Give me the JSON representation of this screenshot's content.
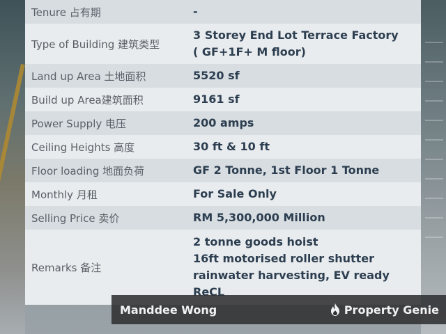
{
  "rows": [
    {
      "label": "Tenure 占有期",
      "value_lines": [
        "-"
      ]
    },
    {
      "label": "Type of Building 建筑类型",
      "value_lines": [
        "3 Storey End Lot Terrace Factory",
        "( GF+1F+ M floor)"
      ]
    },
    {
      "label": "Land up Area 土地面积",
      "value_lines": [
        "5520 sf"
      ]
    },
    {
      "label": "Build up Area建筑面积",
      "value_lines": [
        "9161 sf"
      ]
    },
    {
      "label": "Power Supply 电压",
      "value_lines": [
        "200 amps"
      ]
    },
    {
      "label": "Ceiling Heights 高度",
      "value_lines": [
        "30 ft & 10 ft"
      ]
    },
    {
      "label": "Floor loading 地面负荷",
      "value_lines": [
        "GF 2 Tonne, 1st Floor 1 Tonne"
      ]
    },
    {
      "label": "Monthly 月租",
      "value_lines": [
        "For Sale Only"
      ]
    },
    {
      "label": "Selling Price 卖价",
      "value_lines": [
        "RM 5,300,000 Million"
      ]
    },
    {
      "label": "Remarks 备注",
      "value_lines": [
        "2 tonne goods hoist",
        "16ft motorised roller shutter",
        "rainwater harvesting, EV ready",
        "ReCL"
      ]
    }
  ],
  "watermark": {
    "agent_name": "Manddee Wong",
    "brand_name": "Property Genie",
    "brand_icon": "flame-icon"
  }
}
